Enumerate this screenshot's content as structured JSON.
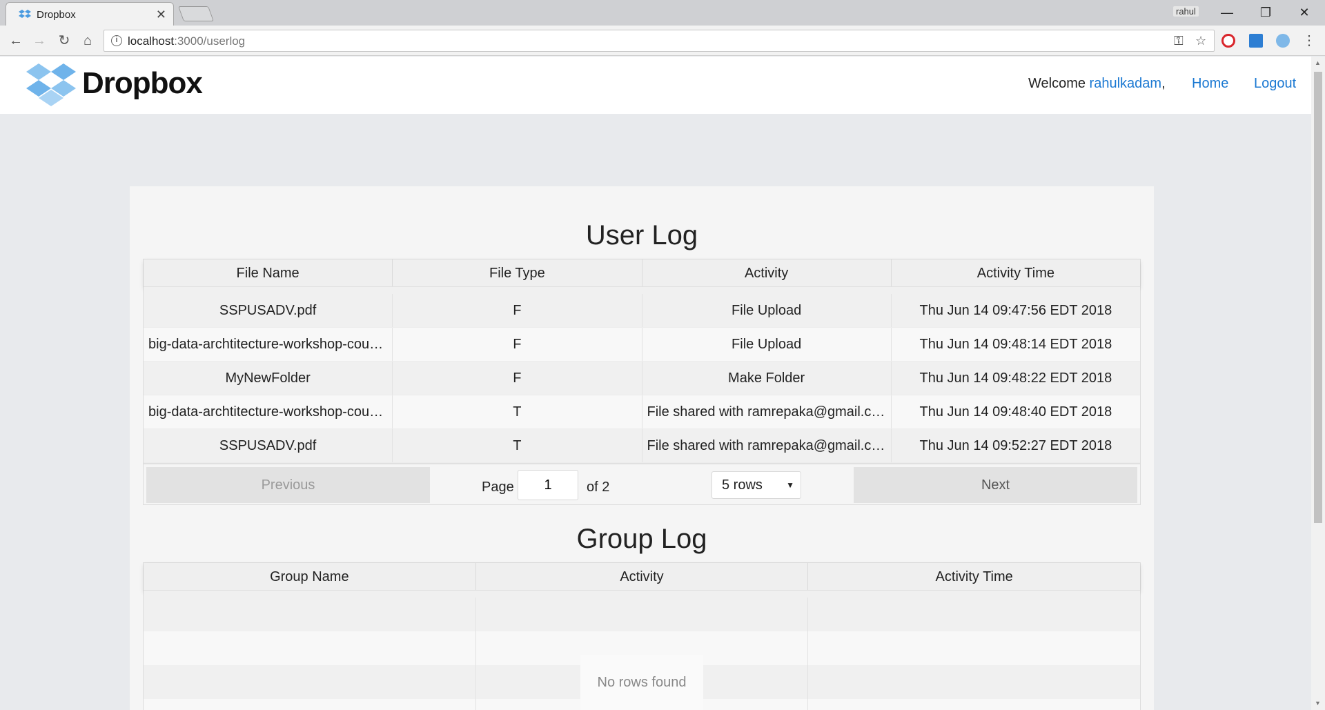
{
  "browser": {
    "tab_title": "Dropbox",
    "tab_close": "✕",
    "profile_name": "rahul",
    "url_host": "localhost",
    "url_path": ":3000/userlog",
    "controls": {
      "minimize": "—",
      "restore": "❐",
      "close": "✕"
    },
    "nav": {
      "back": "←",
      "forward": "→",
      "reload": "↻",
      "home": "⌂"
    },
    "omni_icons": {
      "key": "⚿",
      "star": "☆",
      "menu": "⋮"
    }
  },
  "header": {
    "logo_text": "Dropbox",
    "welcome_label": "Welcome ",
    "username": "rahulkadam",
    "comma": ",",
    "home_link": "Home",
    "logout_link": "Logout"
  },
  "user_log": {
    "title": "User Log",
    "columns": [
      "File Name",
      "File Type",
      "Activity",
      "Activity Time"
    ],
    "rows": [
      [
        "SSPUSADV.pdf",
        "F",
        "File Upload",
        "Thu Jun 14 09:47:56 EDT 2018"
      ],
      [
        "big-data-archtitecture-workshop-course.pdf",
        "F",
        "File Upload",
        "Thu Jun 14 09:48:14 EDT 2018"
      ],
      [
        "MyNewFolder",
        "F",
        "Make Folder",
        "Thu Jun 14 09:48:22 EDT 2018"
      ],
      [
        "big-data-archtitecture-workshop-course.pdf",
        "T",
        "File shared with ramrepaka@gmail.com",
        "Thu Jun 14 09:48:40 EDT 2018"
      ],
      [
        "SSPUSADV.pdf",
        "T",
        "File shared with ramrepaka@gmail.com",
        "Thu Jun 14 09:52:27 EDT 2018"
      ]
    ],
    "pagination": {
      "previous": "Previous",
      "next": "Next",
      "page_label": "Page",
      "current_page": "1",
      "of_label": "of 2",
      "rows_option": "5 rows",
      "caret": "▼"
    }
  },
  "group_log": {
    "title": "Group Log",
    "columns": [
      "Group Name",
      "Activity",
      "Activity Time"
    ],
    "empty_message": "No rows found"
  },
  "colors": {
    "link": "#1a78d2",
    "page_bg": "#e8eaed",
    "card_bg": "#f5f5f5"
  }
}
